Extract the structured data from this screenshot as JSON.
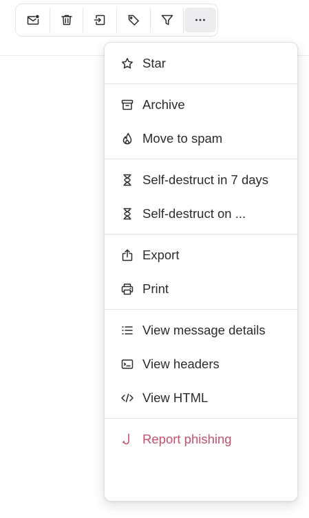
{
  "toolbar": {
    "buttons": [
      {
        "icon": "mark-unread-icon",
        "label": "Mark as unread"
      },
      {
        "icon": "trash-icon",
        "label": "Move to trash"
      },
      {
        "icon": "move-to-folder-icon",
        "label": "Move to folder"
      },
      {
        "icon": "tag-icon",
        "label": "Label as"
      },
      {
        "icon": "filter-icon",
        "label": "Filter"
      },
      {
        "icon": "more-icon",
        "label": "More"
      }
    ]
  },
  "menu": {
    "star": "Star",
    "archive": "Archive",
    "move_to_spam": "Move to spam",
    "self_destruct_7": "Self-destruct in 7 days",
    "self_destruct_on": "Self-destruct on ...",
    "export": "Export",
    "print": "Print",
    "view_details": "View message details",
    "view_headers": "View headers",
    "view_html": "View HTML",
    "report_phishing": "Report phishing"
  },
  "colors": {
    "text": "#2b2b30",
    "danger": "#c4506a",
    "border": "#e4e4e7"
  }
}
